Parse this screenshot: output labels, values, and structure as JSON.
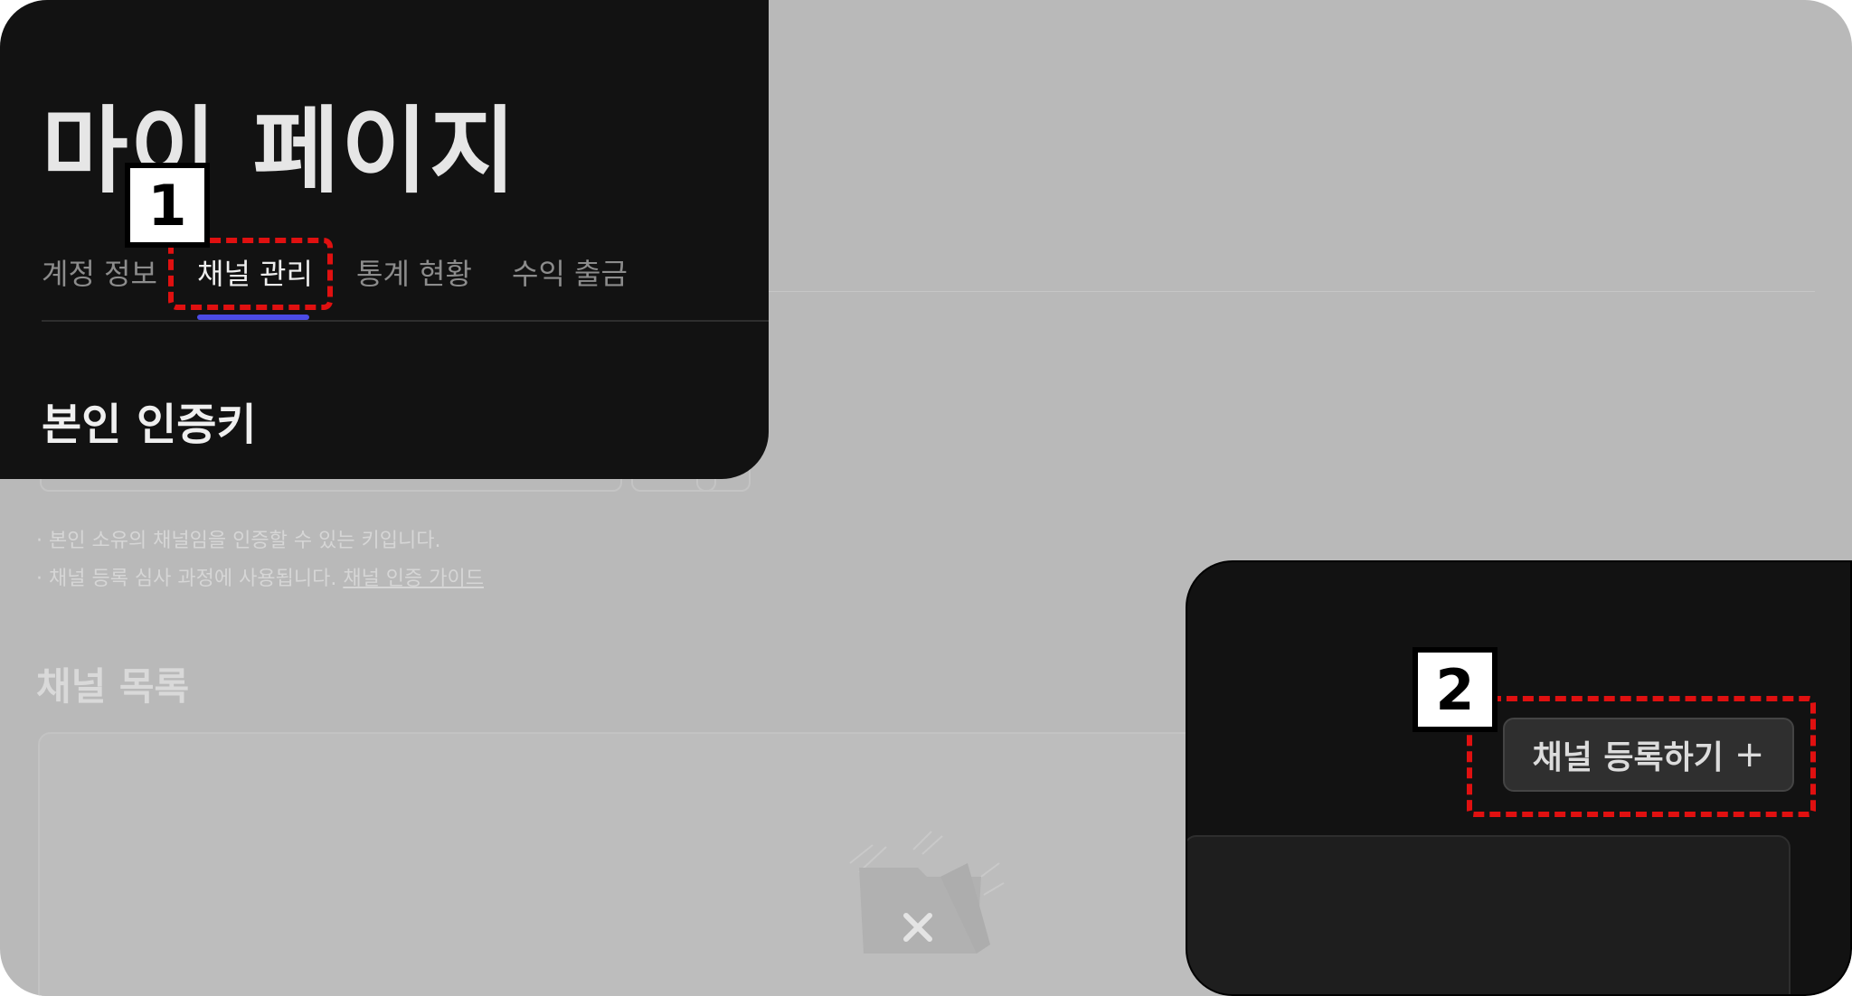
{
  "page": {
    "title": "마이 페이지",
    "tabs": [
      {
        "label": "계정 정보",
        "active": false
      },
      {
        "label": "채널 관리",
        "active": true
      },
      {
        "label": "통계 현황",
        "active": false
      },
      {
        "label": "수익 출금",
        "active": false
      }
    ],
    "accent_color": "#4b4be6"
  },
  "auth_key": {
    "title": "본인 인증키",
    "note_1": "· 본인 소유의 채널임을 인증할 수 있는 키입니다.",
    "note_2": "· 채널 등록 심사 과정에 사용됩니다.",
    "guide_link": "채널 인증 가이드"
  },
  "channel_list": {
    "title": "채널 목록",
    "register_button": "채널 등록하기",
    "register_icon": "plus-icon",
    "empty_icon": "empty-folder-x-icon"
  },
  "annotations": {
    "badge_1": "1",
    "badge_2": "2",
    "highlight_color": "#e01010"
  }
}
